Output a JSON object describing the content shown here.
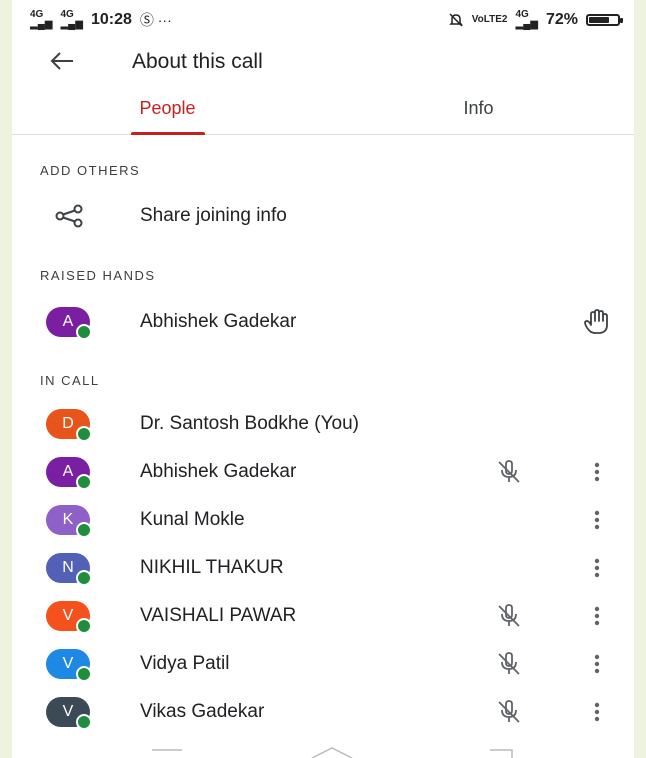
{
  "status_bar": {
    "network_1": "4G",
    "network_2": "4G",
    "time": "10:28",
    "notif_icons": "Ⓢ ···",
    "volte": "VoLTE2",
    "network_3": "4G",
    "battery": "72%",
    "battery_level": 0.72
  },
  "app_bar": {
    "back_icon": "arrow-back-icon",
    "title": "About this call"
  },
  "tabs": [
    {
      "label": "People",
      "active": true
    },
    {
      "label": "Info",
      "active": false
    }
  ],
  "sections": {
    "add_others": {
      "header": "ADD OTHERS",
      "share_label": "Share joining info",
      "share_icon": "share-icon"
    },
    "raised_hands": {
      "header": "RAISED HANDS",
      "person": {
        "initial": "A",
        "name": "Abhishek Gadekar",
        "color": "#7b1fa2",
        "icon": "raised-hand-icon"
      }
    },
    "in_call": {
      "header": "IN CALL",
      "people": [
        {
          "initial": "D",
          "name": "Dr. Santosh Bodkhe (You)",
          "color": "#e8551c",
          "muted": false,
          "menu": false
        },
        {
          "initial": "A",
          "name": "Abhishek Gadekar",
          "color": "#7b1fa2",
          "muted": true,
          "menu": true
        },
        {
          "initial": "K",
          "name": "Kunal Mokle",
          "color": "#8e61c9",
          "muted": false,
          "menu": true
        },
        {
          "initial": "N",
          "name": "NIKHIL THAKUR",
          "color": "#5260b5",
          "muted": false,
          "menu": true
        },
        {
          "initial": "V",
          "name": "VAISHALI PAWAR",
          "color": "#f4511e",
          "muted": true,
          "menu": true
        },
        {
          "initial": "V",
          "name": "Vidya Patil",
          "color": "#1e88e5",
          "muted": true,
          "menu": true
        },
        {
          "initial": "V",
          "name": "Vikas Gadekar",
          "color": "#3c4a55",
          "muted": true,
          "menu": true
        }
      ]
    }
  },
  "colors": {
    "accent": "#c5221f",
    "online": "#1e8e3e",
    "text": "#202124",
    "secondary": "#3c4043"
  }
}
